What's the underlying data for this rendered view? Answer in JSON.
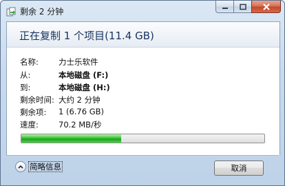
{
  "window": {
    "title": "剩余 2 分钟"
  },
  "header": {
    "title": "正在复制 1 个项目(11.4 GB)"
  },
  "details": [
    {
      "label": "名称:",
      "value": "力士乐软件",
      "bold": false
    },
    {
      "label": "从:",
      "value": "本地磁盘 (F:)",
      "bold": true
    },
    {
      "label": "到:",
      "value": "本地磁盘 (H:)",
      "bold": true
    },
    {
      "label": "剩余时间:",
      "value": "大约 2 分钟",
      "bold": false
    },
    {
      "label": "剩余项:",
      "value": "1 (6.76 GB)",
      "bold": false
    },
    {
      "label": "速度:",
      "value": "70.2 MB/秒",
      "bold": false
    }
  ],
  "progress": {
    "fraction": 0.41,
    "color": "#17a317"
  },
  "footer": {
    "details_toggle": "简略信息",
    "cancel_label": "取消"
  },
  "icons": {
    "app": "copy-files-icon",
    "minimize": "minimize-icon",
    "maximize": "maximize-icon",
    "close": "close-icon",
    "toggle": "chevron-up-icon"
  }
}
